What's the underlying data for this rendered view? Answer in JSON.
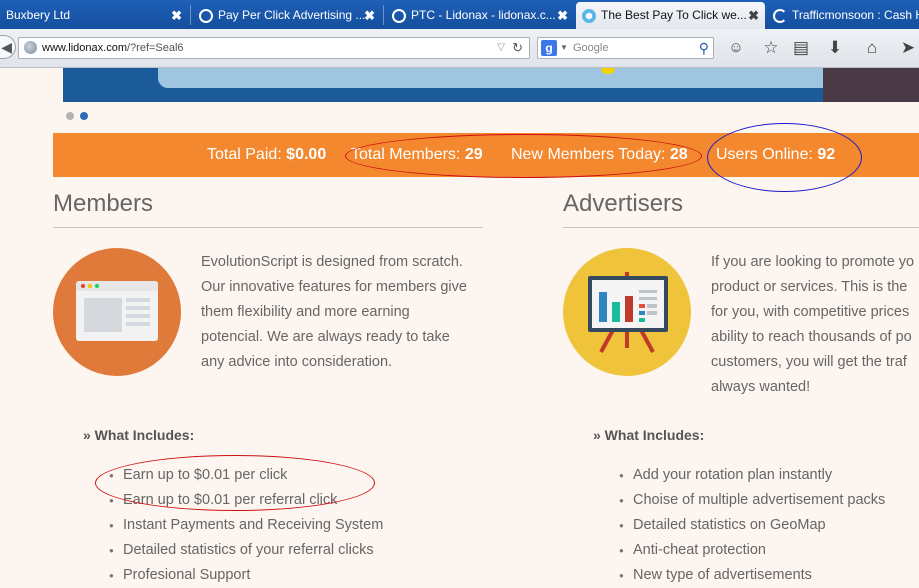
{
  "browser": {
    "tabs": [
      {
        "label": "Buxbery Ltd",
        "active": false
      },
      {
        "label": "Pay Per Click Advertising ...",
        "active": false
      },
      {
        "label": "PTC - Lidonax - lidonax.c...",
        "active": false
      },
      {
        "label": "The Best Pay To Click we...",
        "active": true
      },
      {
        "label": "Trafficmonsoon : Cash Hi...",
        "active": false
      }
    ],
    "close_glyph": "✖",
    "url_domain": "www.lidonax.com",
    "url_path": "/?ref=Seal6",
    "search_placeholder": "Google",
    "search_engine_glyph": "g"
  },
  "stats": {
    "total_paid_label": "Total Paid:",
    "total_paid_value": "$0.00",
    "total_members_label": "Total Members:",
    "total_members_value": "29",
    "new_members_label": "New Members Today:",
    "new_members_value": "28",
    "users_online_label": "Users Online:",
    "users_online_value": "92"
  },
  "members": {
    "title": "Members",
    "description_lines": [
      "EvolutionScript is designed from scratch.",
      "Our innovative features for members give",
      "them flexibility and more earning",
      "potencial. We are always ready to take",
      "any advice into consideration."
    ],
    "includes_label": "» What Includes:",
    "items": [
      "Earn up to $0.01 per click",
      "Earn up to $0.01 per referral click",
      "Instant Payments and Receiving System",
      "Detailed statistics of your referral clicks",
      "Profesional Support"
    ]
  },
  "advertisers": {
    "title": "Advertisers",
    "description_lines": [
      "If you are looking to promote yo",
      "product or services. This is the",
      "for you, with competitive prices",
      "ability to reach thousands of po",
      "customers, you will get the traf",
      "always wanted!"
    ],
    "includes_label": "» What Includes:",
    "items": [
      "Add your rotation plan instantly",
      "Choise of multiple advertisement packs",
      "Detailed statistics on GeoMap",
      "Anti-cheat protection",
      "New type of advertisements"
    ]
  },
  "colors": {
    "stats_bar": "#f3882f",
    "members_circle": "#e07a3a",
    "advertisers_circle": "#efc43a",
    "red_annotation": "#cc1111",
    "blue_annotation": "#1a1acc"
  }
}
